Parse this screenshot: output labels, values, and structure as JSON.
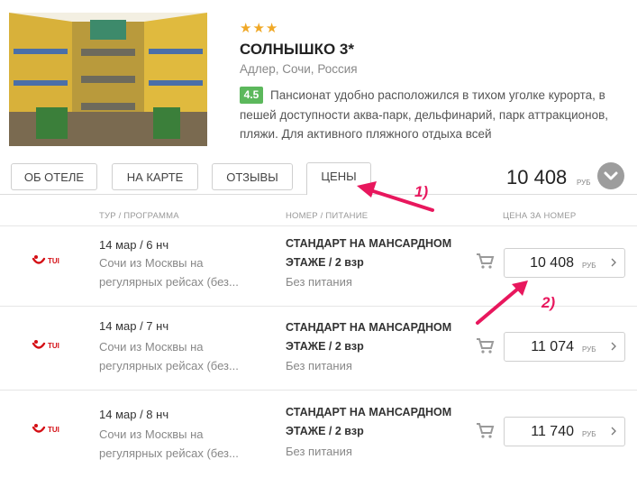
{
  "hotel": {
    "stars": "★★★",
    "name": "СОЛНЫШКО 3*",
    "location": "Адлер, Сочи, Россия",
    "rating": "4.5",
    "description": "Пансионат удобно расположился в тихом уголке курорта, в пешей доступности аква-парк, дельфинарий, парк аттракционов, пляжи. Для активного пляжного отдыха всей"
  },
  "tabs": [
    {
      "label": "ОБ ОТЕЛЕ"
    },
    {
      "label": "НА КАРТЕ"
    },
    {
      "label": "ОТЗЫВЫ"
    },
    {
      "label": "ЦЕНЫ"
    }
  ],
  "header_price": {
    "value": "10 408",
    "currency": "РУБ"
  },
  "columns": {
    "tour": "ТУР / ПРОГРАММА",
    "room": "НОМЕР / ПИТАНИЕ",
    "price": "ЦЕНА ЗА НОМЕР"
  },
  "rows": [
    {
      "operator": "TUI",
      "date": "14 мар / 6 нч",
      "tour_desc_1": "Сочи из Москвы на",
      "tour_desc_2": "регулярных рейсах (без...",
      "room_1": "СТАНДАРТ НА МАНСАРДНОМ",
      "room_2": "ЭТАЖЕ / 2 взр",
      "meal": "Без питания",
      "price": "10 408",
      "currency": "РУБ"
    },
    {
      "operator": "TUI",
      "date": "14 мар / 7 нч",
      "tour_desc_1": "Сочи из Москвы на",
      "tour_desc_2": "регулярных рейсах (без...",
      "room_1": "СТАНДАРТ НА МАНСАРДНОМ",
      "room_2": "ЭТАЖЕ / 2 взр",
      "meal": "Без питания",
      "price": "11 074",
      "currency": "РУБ"
    },
    {
      "operator": "TUI",
      "date": "14 мар / 8 нч",
      "tour_desc_1": "Сочи из Москвы на",
      "tour_desc_2": "регулярных рейсах (без...",
      "room_1": "СТАНДАРТ НА МАНСАРДНОМ",
      "room_2": "ЭТАЖЕ / 2 взр",
      "meal": "Без питания",
      "price": "11 740",
      "currency": "РУБ"
    }
  ],
  "annotations": {
    "a1": "1)",
    "a2": "2)"
  },
  "colors": {
    "accent": "#e8175d",
    "rating_bg": "#5cb85c",
    "stars": "#f0a826",
    "tui_red": "#d40e14"
  },
  "icons": [
    "chevron-down-icon",
    "cart-icon",
    "chevron-right-icon",
    "tui-logo"
  ]
}
